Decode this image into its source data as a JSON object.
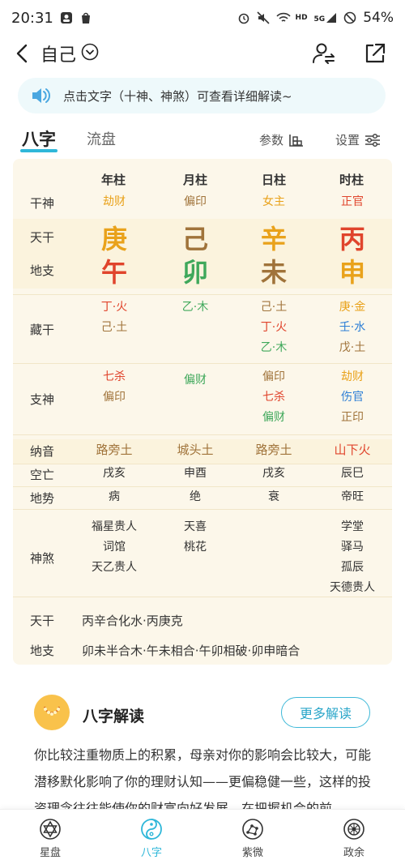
{
  "status": {
    "time": "20:31",
    "battery": "54%",
    "network": "5G",
    "hd": "HD"
  },
  "nav": {
    "title": "自己"
  },
  "tip": {
    "text": "点击文字（十神、神煞）可查看详细解读~"
  },
  "tabs": {
    "items": [
      "八字",
      "流盘"
    ],
    "params_label": "参数",
    "settings_label": "设置"
  },
  "chart": {
    "columns": [
      "年柱",
      "月柱",
      "日柱",
      "时柱"
    ],
    "rows": {
      "shishen_label": "干神",
      "shishen": [
        "劫财",
        "偏印",
        "女主",
        "正官"
      ],
      "tiangan_label": "天干",
      "tiangan": [
        "庚",
        "己",
        "辛",
        "丙"
      ],
      "dizhi_label": "地支",
      "dizhi": [
        "午",
        "卯",
        "未",
        "申"
      ],
      "canggan_label": "藏干",
      "canggan": [
        [
          "丁·火",
          "己·土"
        ],
        [
          "乙·木"
        ],
        [
          "己·土",
          "丁·火",
          "乙·木"
        ],
        [
          "庚·金",
          "壬·水",
          "戊·土"
        ]
      ],
      "zhishen_label": "支神",
      "zhishen": [
        [
          "七杀",
          "偏印"
        ],
        [
          "偏财"
        ],
        [
          "偏印",
          "七杀",
          "偏财"
        ],
        [
          "劫财",
          "伤官",
          "正印"
        ]
      ],
      "nayin_label": "纳音",
      "nayin": [
        "路旁土",
        "城头土",
        "路旁土",
        "山下火"
      ],
      "kongwang_label": "空亡",
      "kongwang": [
        "戌亥",
        "申酉",
        "戌亥",
        "辰巳"
      ],
      "dishi_label": "地势",
      "dishi": [
        "病",
        "绝",
        "衰",
        "帝旺"
      ],
      "shensha_label": "神煞",
      "shensha": [
        [
          "福星贵人",
          "词馆",
          "天乙贵人"
        ],
        [
          "天喜",
          "桃花"
        ],
        [],
        [
          "学堂",
          "驿马",
          "孤辰",
          "天德贵人"
        ]
      ]
    },
    "relations": {
      "tiangan_label": "天干",
      "tiangan_text": "丙辛合化水·丙庚克",
      "dizhi_label": "地支",
      "dizhi_text": "卯未半合木·午未相合·午卯相破·卯申暗合"
    }
  },
  "reading": {
    "title": "八字解读",
    "more_label": "更多解读",
    "paragraph": "你比较注重物质上的积累，母亲对你的影响会比较大，可能潜移默化影响了你的理财认知——更偏稳健一些，这样的投资理念往往能使你的财富向好发展，在把握机会的前"
  },
  "bottom_nav": [
    {
      "label": "星盘",
      "icon": "star-of-david-icon"
    },
    {
      "label": "八字",
      "icon": "yin-yang-icon",
      "active": true
    },
    {
      "label": "紫微",
      "icon": "constellation-icon"
    },
    {
      "label": "政余",
      "icon": "dharma-wheel-icon"
    }
  ],
  "colors": {
    "accent": "#2fb7d9",
    "card_bg": "#fcf7ea",
    "band_bg": "#fbf3dd",
    "metal": "#e9a21b",
    "earth": "#a0733a",
    "fire": "#e0442c",
    "wood": "#3fa85b",
    "water": "#2d7fd6"
  }
}
